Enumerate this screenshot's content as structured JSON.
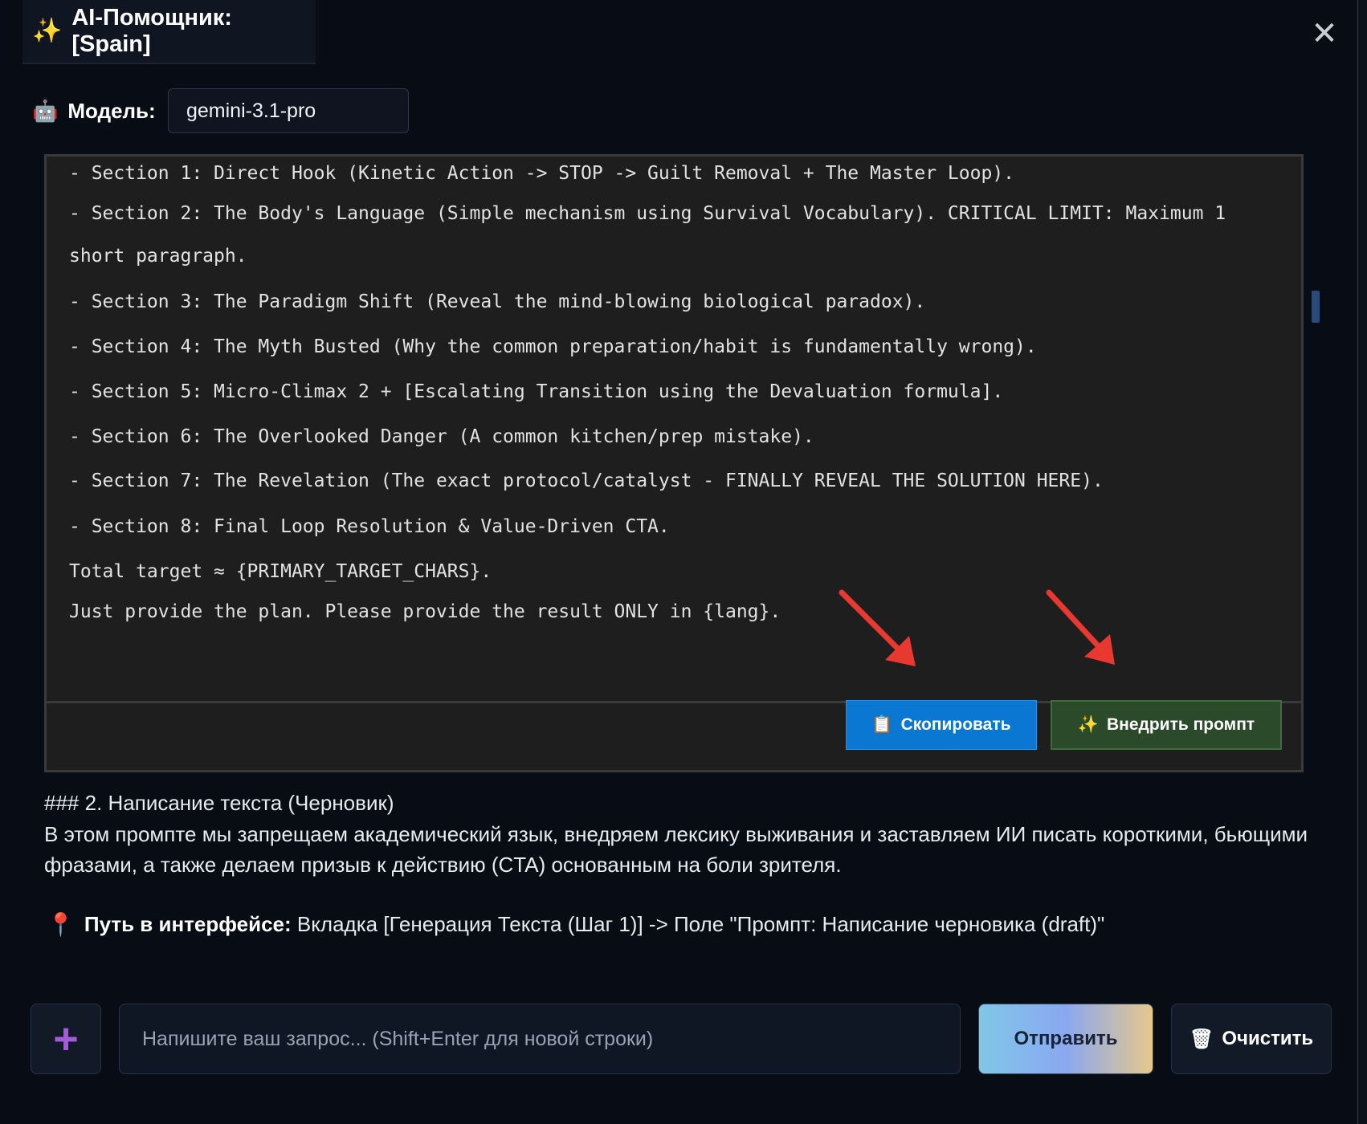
{
  "header": {
    "icon": "sparkle-icon",
    "title": "AI-Помощник: [Spain]",
    "close_symbol": "✕"
  },
  "model": {
    "label": "Модель:",
    "value": "gemini-3.1-pro"
  },
  "code_block": {
    "lines": [
      "- Section 1: Direct Hook (Kinetic Action -> STOP -> Guilt Removal + The Master Loop).",
      "- Section 2: The Body's Language (Simple mechanism using Survival Vocabulary). CRITICAL LIMIT: Maximum 1",
      "short paragraph.",
      "- Section 3: The Paradigm Shift (Reveal the mind-blowing biological paradox).",
      "- Section 4: The Myth Busted (Why the common preparation/habit is fundamentally wrong).",
      "- Section 5: Micro-Climax 2 + [Escalating Transition using the Devaluation formula].",
      "- Section 6: The Overlooked Danger (A common kitchen/prep mistake).",
      "- Section 7: The Revelation (The exact protocol/catalyst - FINALLY REVEAL THE SOLUTION HERE).",
      "- Section 8: Final Loop Resolution & Value-Driven CTA.",
      "Total target ≈ {PRIMARY_TARGET_CHARS}.",
      "Just provide the plan. Please provide the result ONLY in {lang}."
    ],
    "copy_label": "Скопировать",
    "inject_label": "Внедрить промпт"
  },
  "content": {
    "heading": "### 2. Написание текста (Черновик)",
    "paragraph": "В этом промпте мы запрещаем академический язык, внедряем лексику выживания и заставляем ИИ писать короткими, бьющими фразами, а также делаем призыв к действию (CTA) основанным на боли зрителя.",
    "path_label": "Путь в интерфейсе:",
    "path_value": "Вкладка [Генерация Текста (Шаг 1)] -> Поле \"Промпт: Написание черновика (draft)\""
  },
  "composer": {
    "placeholder": "Напишите ваш запрос... (Shift+Enter для новой строки)",
    "send_label": "Отправить",
    "clear_label": "Очистить"
  },
  "colors": {
    "copy_button": "#0a78d2",
    "inject_button": "#2a4a2a",
    "annotation_arrow": "#e8382f",
    "plus_accent": "#a35bd6"
  }
}
